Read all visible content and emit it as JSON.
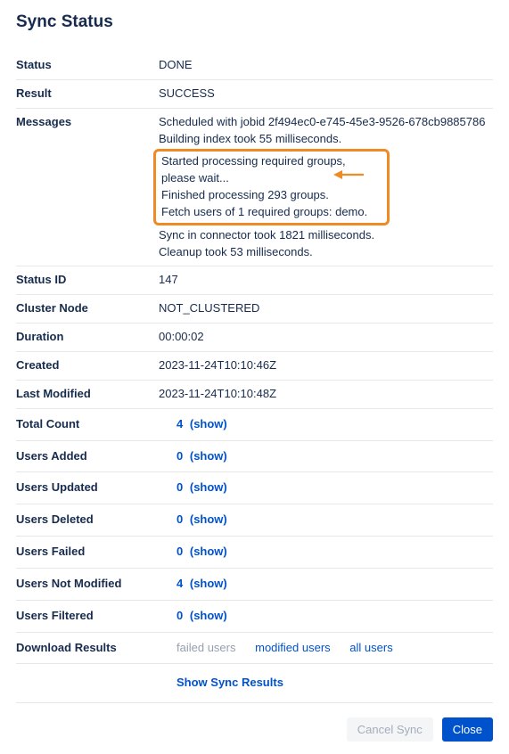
{
  "title": "Sync Status",
  "rows": {
    "status": {
      "label": "Status",
      "value": "DONE"
    },
    "result": {
      "label": "Result",
      "value": "SUCCESS"
    },
    "messages": {
      "label": "Messages",
      "before": [
        "Scheduled with jobid 2f494ec0-e745-45e3-9526-678cb9885786",
        "Building index took 55 milliseconds."
      ],
      "highlighted": [
        "Started processing required groups, please wait...",
        "Finished processing 293 groups.",
        "Fetch users of 1 required groups: demo."
      ],
      "after": [
        "Sync in connector took 1821 milliseconds.",
        "Cleanup took 53 milliseconds."
      ]
    },
    "status_id": {
      "label": "Status ID",
      "value": "147"
    },
    "cluster_node": {
      "label": "Cluster Node",
      "value": "NOT_CLUSTERED"
    },
    "duration": {
      "label": "Duration",
      "value": "00:00:02"
    },
    "created": {
      "label": "Created",
      "value": "2023-11-24T10:10:46Z"
    },
    "last_modified": {
      "label": "Last Modified",
      "value": "2023-11-24T10:10:48Z"
    },
    "total_count": {
      "label": "Total Count",
      "count": "4",
      "show": "(show)"
    },
    "users_added": {
      "label": "Users Added",
      "count": "0",
      "show": "(show)"
    },
    "users_updated": {
      "label": "Users Updated",
      "count": "0",
      "show": "(show)"
    },
    "users_deleted": {
      "label": "Users Deleted",
      "count": "0",
      "show": "(show)"
    },
    "users_failed": {
      "label": "Users Failed",
      "count": "0",
      "show": "(show)"
    },
    "users_not_modified": {
      "label": "Users Not Modified",
      "count": "4",
      "show": "(show)"
    },
    "users_filtered": {
      "label": "Users Filtered",
      "count": "0",
      "show": "(show)"
    },
    "download_results": {
      "label": "Download Results",
      "failed": "failed users",
      "modified": "modified users",
      "all": "all users"
    },
    "show_sync_results": "Show Sync Results"
  },
  "footer": {
    "cancel": "Cancel Sync",
    "close": "Close"
  }
}
